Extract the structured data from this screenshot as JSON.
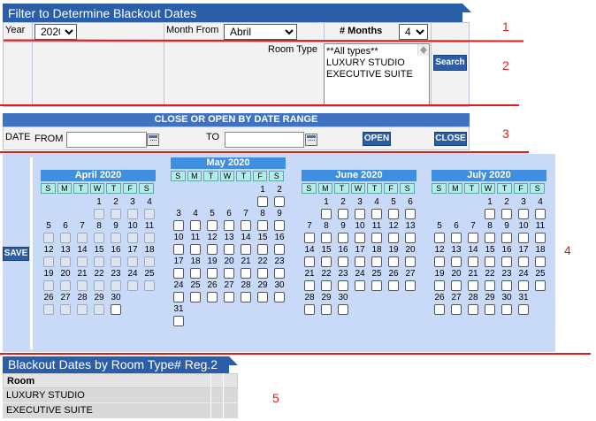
{
  "filter": {
    "title": "Filter to Determine Blackout Dates",
    "year_label": "Year",
    "year_value": "2020",
    "month_from_label": "Month From",
    "month_from_value": "Abril",
    "months_label": "# Months",
    "months_value": "4",
    "room_type_label": "Room Type",
    "room_types": [
      "**All types**",
      "LUXURY STUDIO",
      "EXECUTIVE SUITE"
    ],
    "search_label": "Search"
  },
  "range": {
    "title": "CLOSE OR OPEN BY DATE RANGE",
    "date_label": "DATE",
    "from_label": "FROM",
    "to_label": "TO",
    "open_label": "OPEN",
    "close_label": "CLOSE"
  },
  "calendar": {
    "save_label": "SAVE",
    "dow": [
      "S",
      "M",
      "T",
      "W",
      "T",
      "F",
      "S"
    ],
    "months": [
      {
        "title": "April 2020",
        "start": 3,
        "days": 30,
        "disabled_through": 29
      },
      {
        "title": "May 2020",
        "start": 5,
        "days": 31,
        "disabled_through": 0
      },
      {
        "title": "June 2020",
        "start": 1,
        "days": 30,
        "disabled_through": 0
      },
      {
        "title": "July 2020",
        "start": 3,
        "days": 31,
        "disabled_through": 0
      }
    ]
  },
  "blackout": {
    "title": "Blackout Dates by Room Type# Reg.2",
    "header": "Room",
    "rows": [
      "LUXURY STUDIO",
      "EXECUTIVE SUITE"
    ]
  },
  "annotations": [
    "1",
    "2",
    "3",
    "4",
    "5"
  ],
  "colors": {
    "accent": "#2a5ea8",
    "calendar_bg": "#c8daf7",
    "annotation": "#e31b1b"
  }
}
